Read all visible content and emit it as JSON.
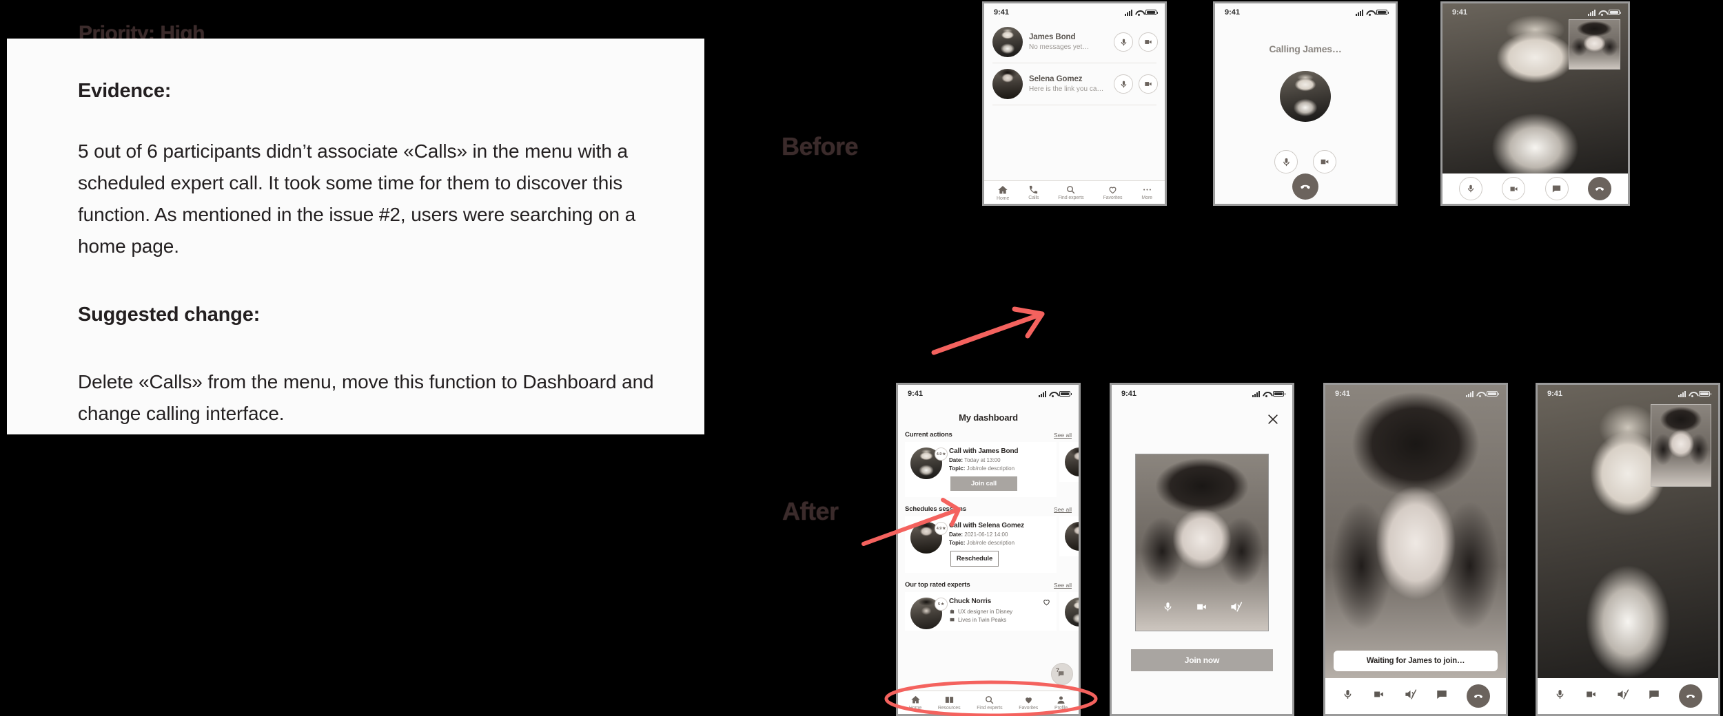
{
  "slide": {
    "priority_label": "Priority: High",
    "before_label": "Before",
    "after_label": "After",
    "accent_red": "#f4625e",
    "text_color": "#231f20",
    "card_bg": "#fbfbfb"
  },
  "content": {
    "evidence_heading": "Evidence:",
    "evidence_body": "5 out of 6 participants didn’t associate «Calls» in the menu with a scheduled expert call. It took some time for them to discover this function. As mentioned in the issue #2, users were searching on a home page.",
    "suggested_heading": "Suggested change:",
    "suggested_body": "Delete «Calls» from the menu, move this function to Dashboard and change calling interface."
  },
  "status_bar": {
    "time": "9:41"
  },
  "before": {
    "chat_screen": {
      "rows": [
        {
          "name": "James Bond",
          "preview": "No messages yet…",
          "mic_icon": "microphone-icon",
          "video_icon": "video-camera-icon"
        },
        {
          "name": "Selena Gomez",
          "preview": "Here is the link you ca…",
          "mic_icon": "microphone-icon",
          "video_icon": "video-camera-icon"
        }
      ],
      "tabs": [
        {
          "label": "Home",
          "icon": "home-icon"
        },
        {
          "label": "Calls",
          "icon": "phone-icon"
        },
        {
          "label": "Find experts",
          "icon": "search-icon"
        },
        {
          "label": "Favorites",
          "icon": "heart-outline-icon"
        },
        {
          "label": "More",
          "icon": "ellipsis-icon"
        }
      ]
    },
    "calling_screen": {
      "title": "Calling James…",
      "controls": [
        "microphone-icon",
        "video-camera-icon"
      ],
      "hangup_icon": "hangup-phone-icon"
    },
    "video_screen": {
      "controls": [
        "microphone-icon",
        "video-camera-icon",
        "chat-bubble-icon",
        "hangup-phone-icon"
      ]
    }
  },
  "after": {
    "dashboard": {
      "title": "My dashboard",
      "sections": [
        {
          "title": "Current actions",
          "see_all": "See all",
          "card": {
            "title": "Call with James Bond",
            "date_label": "Date:",
            "date_value": "Today at 13:00",
            "topic_label": "Topic:",
            "topic_value": "Job/role description",
            "rating": "4.9",
            "button": "Join call",
            "button_style": "solid"
          }
        },
        {
          "title": "Schedules sessions",
          "see_all": "See all",
          "card": {
            "title": "Call with Selena Gomez",
            "date_label": "Date:",
            "date_value": "2021-06-12 14:00",
            "topic_label": "Topic:",
            "topic_value": "Job/role description",
            "rating": "4.9",
            "button": "Reschedule",
            "button_style": "outline"
          }
        },
        {
          "title": "Our top rated experts",
          "see_all": "See all",
          "card": {
            "title": "Chuck Norris",
            "rating": "5",
            "meta1": "UX designer in Disney",
            "meta2": "Lives in Twin Peaks",
            "favorite_icon": "heart-outline-icon"
          }
        }
      ],
      "help_fab_icon": "help-chat-icon",
      "tabs": [
        {
          "label": "Home",
          "icon": "home-icon"
        },
        {
          "label": "Resources",
          "icon": "book-icon"
        },
        {
          "label": "Find experts",
          "icon": "search-icon"
        },
        {
          "label": "Favorites",
          "icon": "heart-filled-icon"
        },
        {
          "label": "Profile",
          "icon": "person-icon"
        }
      ]
    },
    "join_screen": {
      "close_icon": "close-icon",
      "preview_controls": [
        "microphone-icon",
        "video-camera-icon",
        "speaker-muted-icon"
      ],
      "join_button": "Join now"
    },
    "waiting_screen": {
      "status_text": "Waiting for James to join…",
      "controls": [
        "microphone-icon",
        "video-camera-icon",
        "speaker-muted-icon",
        "chat-bubble-icon",
        "hangup-phone-icon"
      ]
    },
    "call_screen": {
      "controls": [
        "microphone-icon",
        "video-camera-icon",
        "speaker-muted-icon",
        "chat-bubble-icon",
        "hangup-phone-icon"
      ]
    }
  }
}
